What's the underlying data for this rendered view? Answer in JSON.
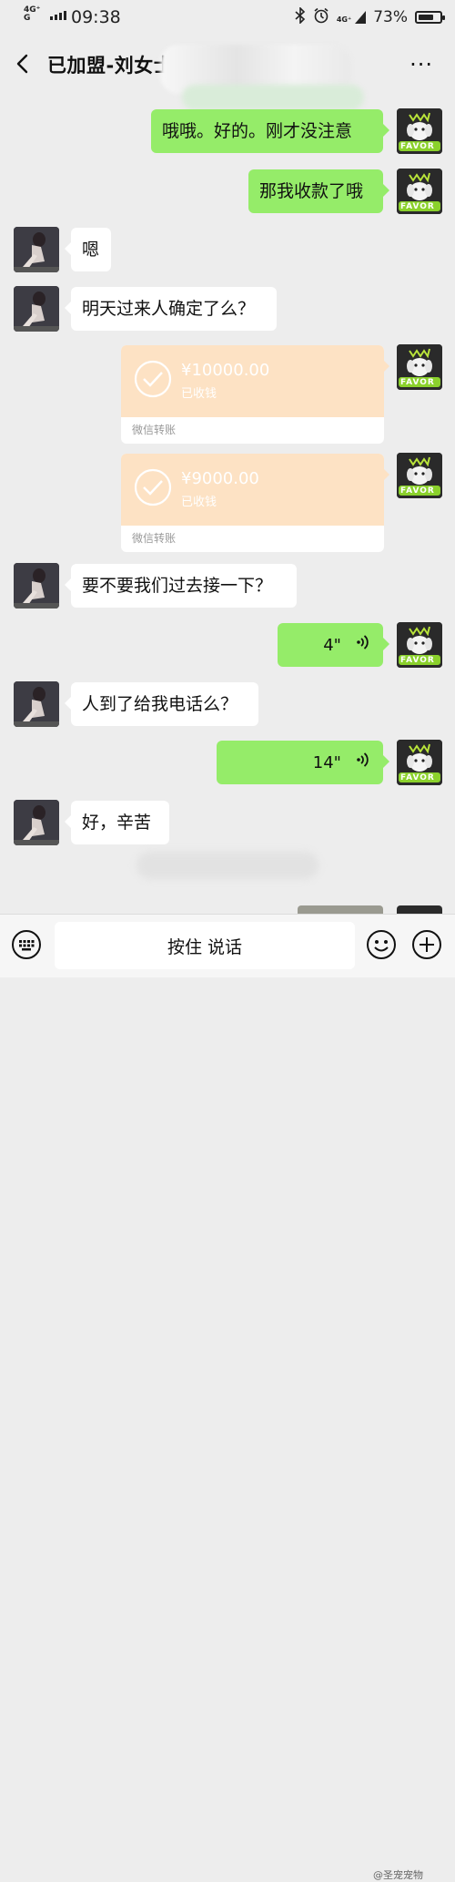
{
  "status_bar": {
    "network_1": "4G⁺",
    "network_2": "G",
    "time": "09:38",
    "network_right": "4G⁺",
    "battery": "73%",
    "battery_level": 0.73,
    "icons": [
      "bluetooth-icon",
      "alarm-icon",
      "signal-icon",
      "battery-icon"
    ]
  },
  "header": {
    "title": "已加盟-刘女士",
    "more": "···",
    "icons": [
      "back-arrow-icon",
      "more-icon"
    ]
  },
  "messages": [
    {
      "sender": "me",
      "type": "text",
      "text": "哦哦。好的。刚才没注意"
    },
    {
      "sender": "me",
      "type": "text",
      "text": "那我收款了哦"
    },
    {
      "sender": "them",
      "type": "text",
      "text": "嗯"
    },
    {
      "sender": "them",
      "type": "text",
      "text": "明天过来人确定了么？"
    },
    {
      "sender": "me",
      "type": "transfer",
      "amount": "¥10000.00",
      "status": "已收钱",
      "footer": "微信转账"
    },
    {
      "sender": "me",
      "type": "transfer",
      "amount": "¥9000.00",
      "status": "已收钱",
      "footer": "微信转账"
    },
    {
      "sender": "them",
      "type": "text",
      "text": "要不要我们过去接一下？"
    },
    {
      "sender": "me",
      "type": "voice",
      "duration": "4\""
    },
    {
      "sender": "them",
      "type": "text",
      "text": "人到了给我电话么？"
    },
    {
      "sender": "me",
      "type": "voice",
      "duration": "14\""
    },
    {
      "sender": "them",
      "type": "text",
      "text": "好，辛苦"
    }
  ],
  "avatar_me_text": "FAVOR",
  "input_bar": {
    "hold_to_talk": "按住 说话",
    "icons": [
      "keyboard-icon",
      "emoji-icon",
      "plus-icon"
    ]
  },
  "watermark": "@圣宠宠物",
  "colors": {
    "background": "#ededed",
    "my_bubble": "#95ec69",
    "their_bubble": "#ffffff",
    "transfer_card": "#fde2c4"
  }
}
